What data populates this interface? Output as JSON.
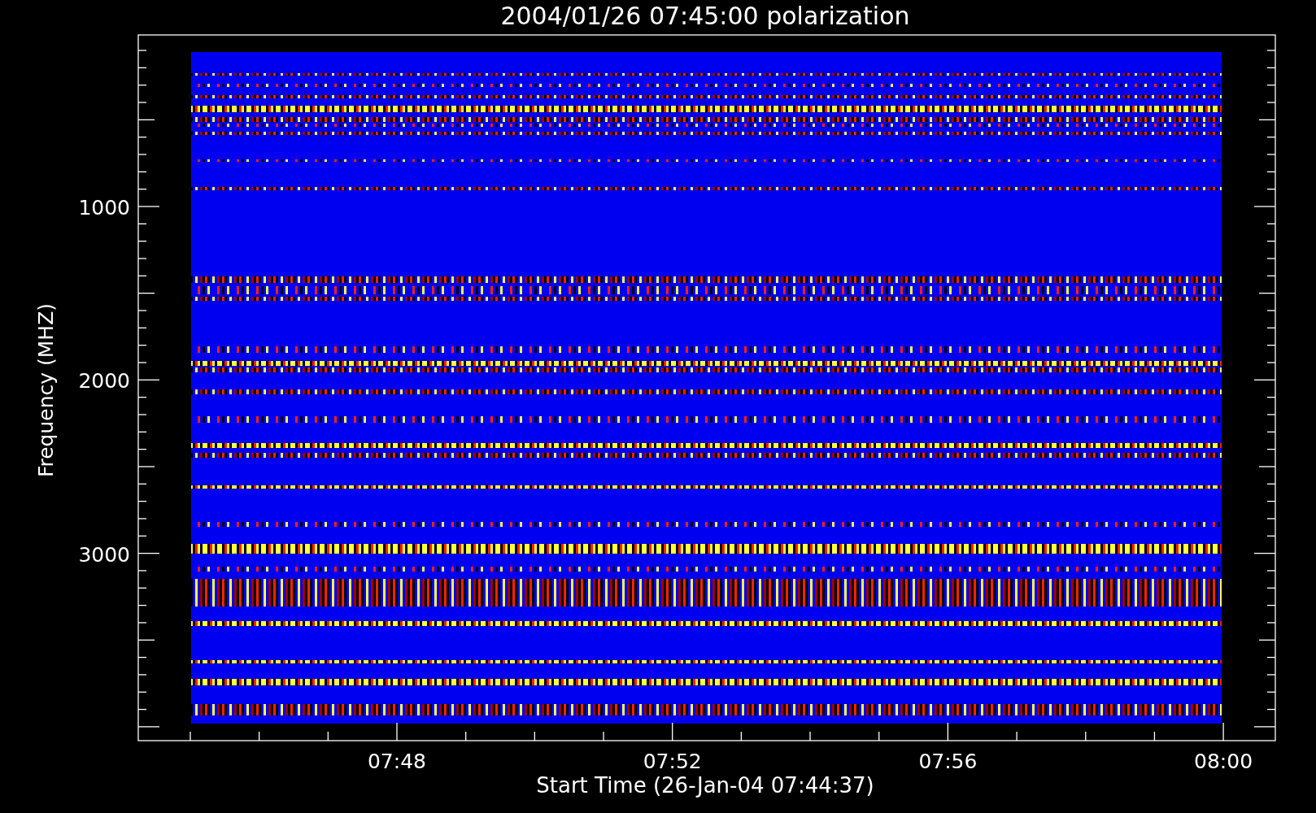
{
  "title": "2004/01/26 07:45:00 polarization",
  "y_axis": {
    "label": "Frequency (MHZ)",
    "ticks": [
      "1000",
      "2000",
      "3000"
    ]
  },
  "x_axis": {
    "label": "Start Time (26-Jan-04 07:44:37)",
    "ticks": [
      "07:48",
      "07:52",
      "07:56",
      "08:00"
    ]
  }
}
